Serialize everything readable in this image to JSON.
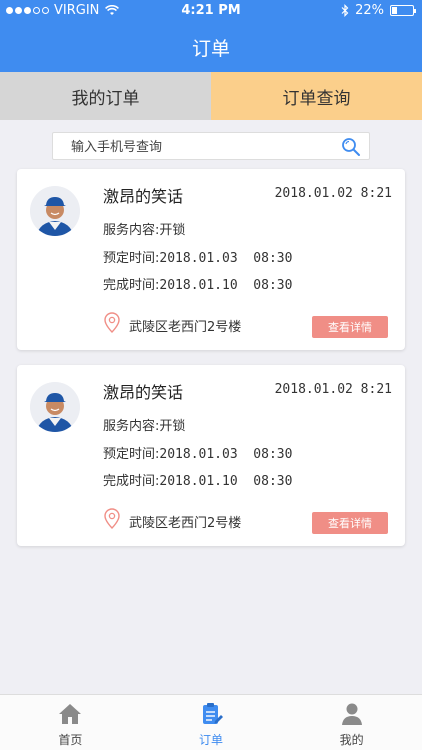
{
  "status_bar": {
    "carrier": "VIRGIN",
    "time": "4:21 PM",
    "battery": "22%"
  },
  "nav": {
    "title": "订单"
  },
  "tabs": [
    {
      "label": "我的订单",
      "active": false
    },
    {
      "label": "订单查询",
      "active": true
    }
  ],
  "search": {
    "placeholder": "输入手机号查询",
    "value": ""
  },
  "orders": [
    {
      "name": "激昂的笑话",
      "date": "2018.01.02 8:21",
      "service_label": "服务内容:",
      "service": "开锁",
      "scheduled_label": "预定时间:",
      "scheduled": "2018.01.03  08:30",
      "finished_label": "完成时间:",
      "finished": "2018.01.10  08:30",
      "address": "武陵区老西门2号楼",
      "detail_label": "查看详情"
    },
    {
      "name": "激昂的笑话",
      "date": "2018.01.02 8:21",
      "service_label": "服务内容:",
      "service": "开锁",
      "scheduled_label": "预定时间:",
      "scheduled": "2018.01.03  08:30",
      "finished_label": "完成时间:",
      "finished": "2018.01.10  08:30",
      "address": "武陵区老西门2号楼",
      "detail_label": "查看详情"
    }
  ],
  "tabbar": [
    {
      "label": "首页",
      "icon": "home-icon"
    },
    {
      "label": "订单",
      "icon": "order-icon",
      "active": true
    },
    {
      "label": "我的",
      "icon": "person-icon"
    }
  ],
  "colors": {
    "primary": "#3f8cf0",
    "tab_active": "#fbcf8b",
    "tab_inactive": "#d6d6d6",
    "detail_button": "#f08e86"
  }
}
